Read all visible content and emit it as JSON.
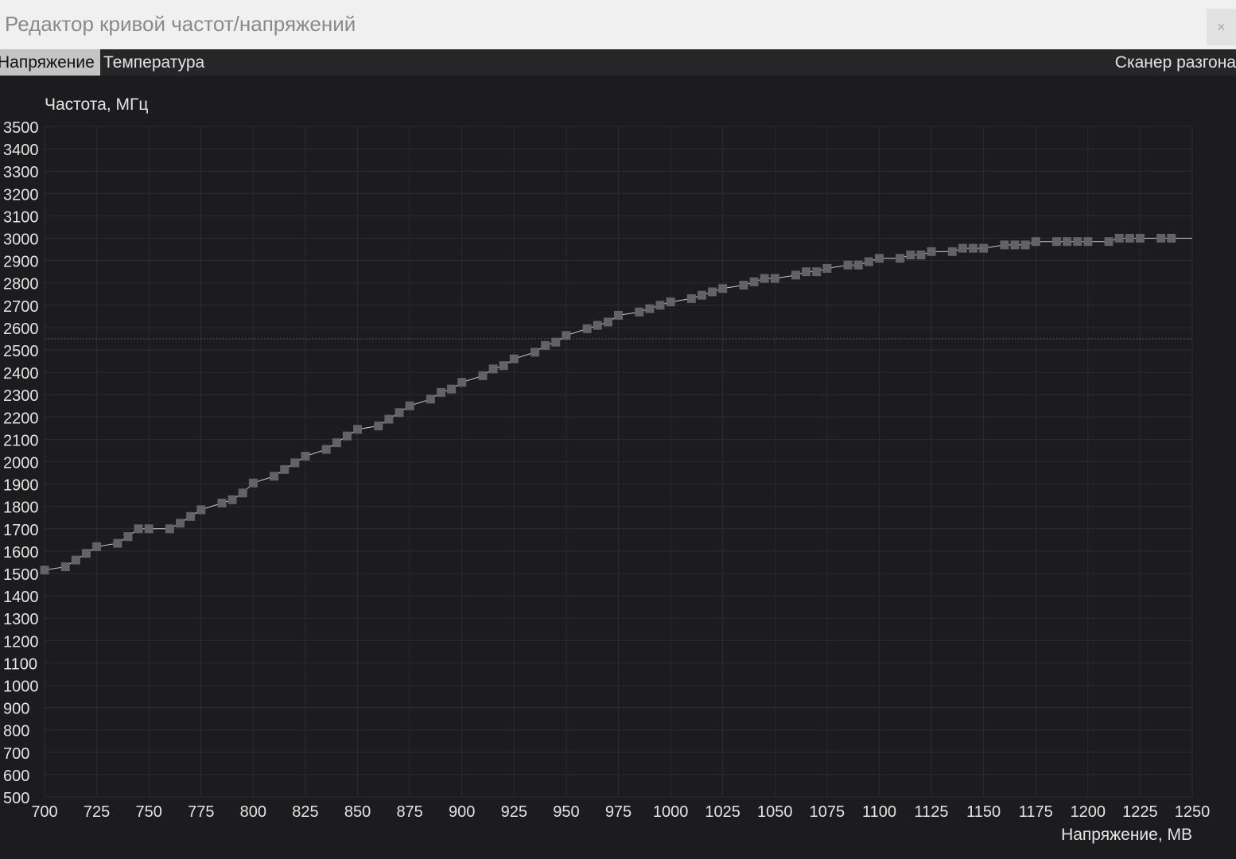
{
  "window": {
    "title": "Редактор кривой частот/напряжений",
    "close_glyph": "×"
  },
  "tabs": [
    {
      "label": "Напряжение",
      "active": true
    },
    {
      "label": "Температура",
      "active": false
    }
  ],
  "scanner_label": "Сканер разгона",
  "colors": {
    "background": "#1c1c1e",
    "grid": "#2c2c2e",
    "point": "#636366",
    "line": "#d0d0d0",
    "text": "#e4e4e4"
  },
  "chart_data": {
    "type": "line",
    "title": "",
    "xlabel": "Напряжение, МВ",
    "ylabel": "Частота, МГц",
    "xlim": [
      700,
      1250
    ],
    "ylim": [
      500,
      3500
    ],
    "x_ticks": [
      700,
      725,
      750,
      775,
      800,
      825,
      850,
      875,
      900,
      925,
      950,
      975,
      1000,
      1025,
      1050,
      1075,
      1100,
      1125,
      1150,
      1175,
      1200,
      1225,
      1250
    ],
    "y_ticks": [
      500,
      600,
      700,
      800,
      900,
      1000,
      1100,
      1200,
      1300,
      1400,
      1500,
      1600,
      1700,
      1800,
      1900,
      2000,
      2100,
      2200,
      2300,
      2400,
      2500,
      2600,
      2700,
      2800,
      2900,
      3000,
      3100,
      3200,
      3300,
      3400,
      3500
    ],
    "grid": true,
    "reference_line_y": 2550,
    "series": [
      {
        "x": [
          700,
          710,
          715,
          720,
          725,
          735,
          740,
          745,
          750,
          760,
          765,
          770,
          775,
          785,
          790,
          795,
          800,
          810,
          815,
          820,
          825,
          835,
          840,
          845,
          850,
          860,
          865,
          870,
          875,
          885,
          890,
          895,
          900,
          910,
          915,
          920,
          925,
          935,
          940,
          945,
          950,
          960,
          965,
          970,
          975,
          985,
          990,
          995,
          1000,
          1010,
          1015,
          1020,
          1025,
          1035,
          1040,
          1045,
          1050,
          1060,
          1065,
          1070,
          1075,
          1085,
          1090,
          1095,
          1100,
          1110,
          1115,
          1120,
          1125,
          1135,
          1140,
          1145,
          1150,
          1160,
          1165,
          1170,
          1175,
          1185,
          1190,
          1195,
          1200,
          1210,
          1215,
          1220,
          1225,
          1235,
          1240
        ],
        "values": [
          1515,
          1530,
          1560,
          1590,
          1620,
          1635,
          1665,
          1700,
          1700,
          1700,
          1725,
          1755,
          1785,
          1815,
          1830,
          1860,
          1905,
          1935,
          1965,
          1995,
          2025,
          2055,
          2085,
          2115,
          2145,
          2160,
          2190,
          2220,
          2250,
          2280,
          2310,
          2325,
          2355,
          2385,
          2415,
          2430,
          2460,
          2490,
          2520,
          2535,
          2565,
          2595,
          2610,
          2625,
          2655,
          2670,
          2685,
          2700,
          2715,
          2730,
          2745,
          2760,
          2775,
          2790,
          2805,
          2820,
          2820,
          2835,
          2850,
          2850,
          2865,
          2880,
          2880,
          2895,
          2910,
          2910,
          2925,
          2925,
          2940,
          2940,
          2955,
          2955,
          2955,
          2970,
          2970,
          2970,
          2985,
          2985,
          2985,
          2985,
          2985,
          2985,
          3000,
          3000,
          3000,
          3000,
          3000
        ],
        "line_end_x": 1250,
        "line_end_value": 3000
      }
    ]
  }
}
